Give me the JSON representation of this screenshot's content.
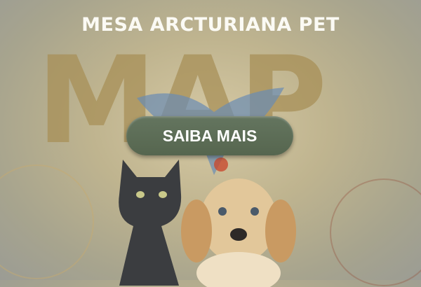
{
  "banner": {
    "title": "MESA ARCTURIANA PET",
    "logo_text": "MAP",
    "cta_label": "SAIBA MAIS"
  },
  "colors": {
    "button": "#5a6b55",
    "gold": "#a89058"
  }
}
